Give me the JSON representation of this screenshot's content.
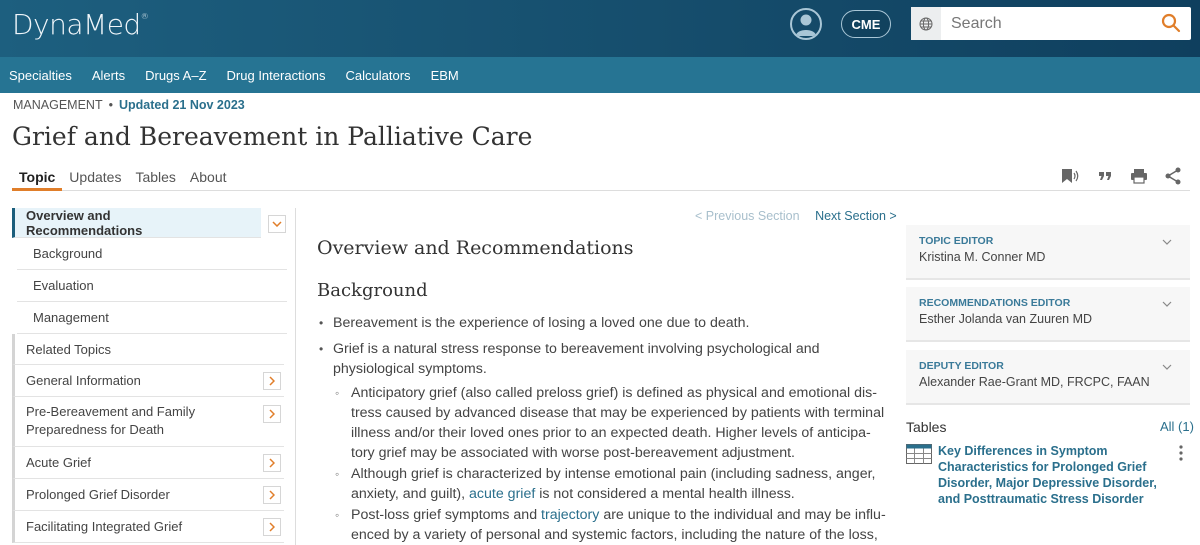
{
  "app": {
    "logo": "DynaMed",
    "logo_mark": "®",
    "cme_label": "CME",
    "search_placeholder": "Search"
  },
  "nav": [
    "Specialties",
    "Alerts",
    "Drugs A–Z",
    "Drug Interactions",
    "Calculators",
    "EBM"
  ],
  "topic": {
    "category": "MANAGEMENT",
    "updated": "Updated 21 Nov 2023",
    "title": "Grief and Bereavement in Palliative Care"
  },
  "tabs": [
    {
      "label": "Topic",
      "active": true
    },
    {
      "label": "Updates",
      "active": false
    },
    {
      "label": "Tables",
      "active": false
    },
    {
      "label": "About",
      "active": false
    }
  ],
  "sidebar": {
    "active": "Overview and Recommendations",
    "sub_items": [
      "Background",
      "Evaluation",
      "Management"
    ],
    "items": [
      "Related Topics",
      "General Information",
      "Pre-Bereavement and Family Preparedness for Death",
      "Acute Grief",
      "Prolonged Grief Disorder",
      "Facilitating Integrated Grief"
    ]
  },
  "section_nav": {
    "prev": "< Previous Section",
    "next": "Next Section >"
  },
  "content": {
    "heading": "Overview and Recommendations",
    "subheading": "Background",
    "bullet1": "Bereavement is the experience of losing a loved one due to death.",
    "bullet2": "Grief is a natural stress response to bereavement involving psychological and physiologi­cal symptoms.",
    "sub1": "Anticipatory grief (also called preloss grief) is defined as physical and emotional dis­tress caused by advanced disease that may be experienced by patients with terminal illness and/or their loved ones prior to an expected death. Higher levels of anticipa­tory grief may be associated with worse post-bereavement adjustment.",
    "sub2_pre": "Although grief is characterized by intense emotional pain (including sadness, anger, anxiety, and guilt), ",
    "sub2_link": "acute grief",
    "sub2_post": " is not considered a mental health illness.",
    "sub3_pre": "Post-loss grief symptoms and ",
    "sub3_link": "trajectory",
    "sub3_post": " are unique to the individual and may be influ­enced by a variety of personal and systemic factors, including the nature of the loss,"
  },
  "editors": [
    {
      "role": "TOPIC EDITOR",
      "name": "Kristina M. Conner MD"
    },
    {
      "role": "RECOMMENDATIONS EDITOR",
      "name": "Esther Jolanda van Zuuren MD"
    },
    {
      "role": "DEPUTY EDITOR",
      "name": "Alexander Rae-Grant MD, FRCPC, FAAN"
    }
  ],
  "tables_panel": {
    "heading": "Tables",
    "all_label": "All (1)",
    "item": "Key Differences in Symptom Characteristics for Prolonged Grief Disorder, Major Depressive Disorder, and Posttraumatic Stress Disorder"
  },
  "colors": {
    "header": "#154c6b",
    "nav": "#267493",
    "accent": "#e07e2a",
    "link": "#2a6f8c"
  }
}
